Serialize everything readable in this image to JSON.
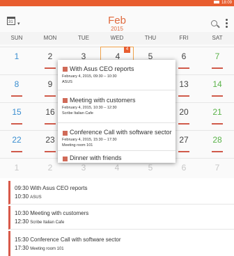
{
  "status": {
    "time": "18:09"
  },
  "header": {
    "month": "Feb",
    "year": "2015"
  },
  "weekdays": [
    "SUN",
    "MON",
    "TUE",
    "WED",
    "THU",
    "FRI",
    "SAT"
  ],
  "calendar": {
    "rows": [
      [
        "1",
        "2",
        "3",
        "4",
        "5",
        "6",
        "7"
      ],
      [
        "8",
        "9",
        "10",
        "11",
        "12",
        "13",
        "14"
      ],
      [
        "15",
        "16",
        "17",
        "18",
        "19",
        "20",
        "21"
      ],
      [
        "22",
        "23",
        "24",
        "25",
        "26",
        "27",
        "28"
      ],
      [
        "1",
        "2",
        "3",
        "4",
        "5",
        "6",
        "7"
      ],
      [
        "8",
        "9",
        "10",
        "11",
        "12",
        "13",
        "14"
      ]
    ],
    "today_badge": "4"
  },
  "popup": {
    "items": [
      {
        "title": "With Asus CEO reports",
        "line1": "February 4, 2015, 09:30 – 10:30",
        "line2": "ASUS"
      },
      {
        "title": "Meeting with customers",
        "line1": "February 4, 2015, 10:30 – 12:30",
        "line2": "Scribe Italian Cafe"
      },
      {
        "title": "Conference Call with software sector",
        "line1": "February 4, 2015, 15:30 – 17:30",
        "line2": "Meeting room 101"
      },
      {
        "title": "Dinner with friends",
        "line1": "",
        "line2": ""
      }
    ]
  },
  "events": [
    {
      "start": "09:30",
      "title": "With Asus CEO reports",
      "end": "10:30",
      "location": "ASUS"
    },
    {
      "start": "10:30",
      "title": "Meeting with customers",
      "end": "12:30",
      "location": "Scribe Italian Cafe"
    },
    {
      "start": "15:30",
      "title": "Conference Call with software sector",
      "end": "17:30",
      "location": "Meeting room 101"
    }
  ],
  "colors": {
    "accent": "#e85d2f",
    "event": "#d85a4a",
    "sunday": "#3a8ed0",
    "saturday": "#5bb34a"
  }
}
